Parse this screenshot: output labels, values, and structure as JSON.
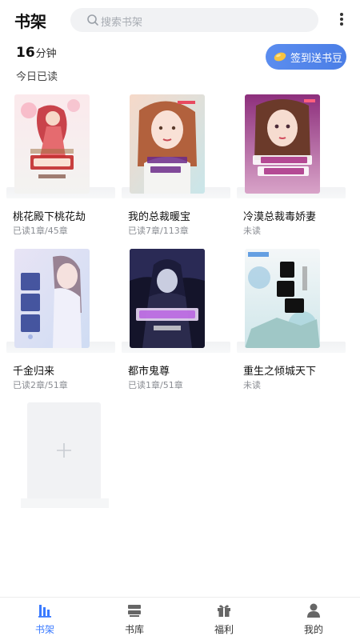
{
  "header": {
    "title": "书架",
    "search_placeholder": "搜索书架",
    "search_icon": "search-icon",
    "more_icon": "more-vertical-icon"
  },
  "stats": {
    "minutes_value": "16",
    "minutes_unit": "分钟",
    "today_label": "今日已读"
  },
  "checkin_button": {
    "label": "签到送书豆",
    "icon": "bean-icon"
  },
  "books": [
    {
      "title": "桃花殿下桃花劫",
      "progress": "已读1章/45章"
    },
    {
      "title": "我的总裁暖宝",
      "progress": "已读7章/113章"
    },
    {
      "title": "冷漠总裁毒娇妻",
      "progress": "未读"
    },
    {
      "title": "千金归来",
      "progress": "已读2章/51章"
    },
    {
      "title": "都市鬼尊",
      "progress": "已读1章/51章"
    },
    {
      "title": "重生之倾城天下",
      "progress": "未读"
    }
  ],
  "add_book": {
    "icon": "plus-icon"
  },
  "tabbar": {
    "active": "书架",
    "tabs": [
      {
        "label": "书架",
        "icon": "bookshelf-icon"
      },
      {
        "label": "书库",
        "icon": "library-icon"
      },
      {
        "label": "福利",
        "icon": "gift-icon"
      },
      {
        "label": "我的",
        "icon": "user-icon"
      }
    ]
  },
  "colors": {
    "accent": "#3b7bff",
    "button_gradient_start": "#5b8def",
    "button_gradient_end": "#4b7ee6"
  }
}
